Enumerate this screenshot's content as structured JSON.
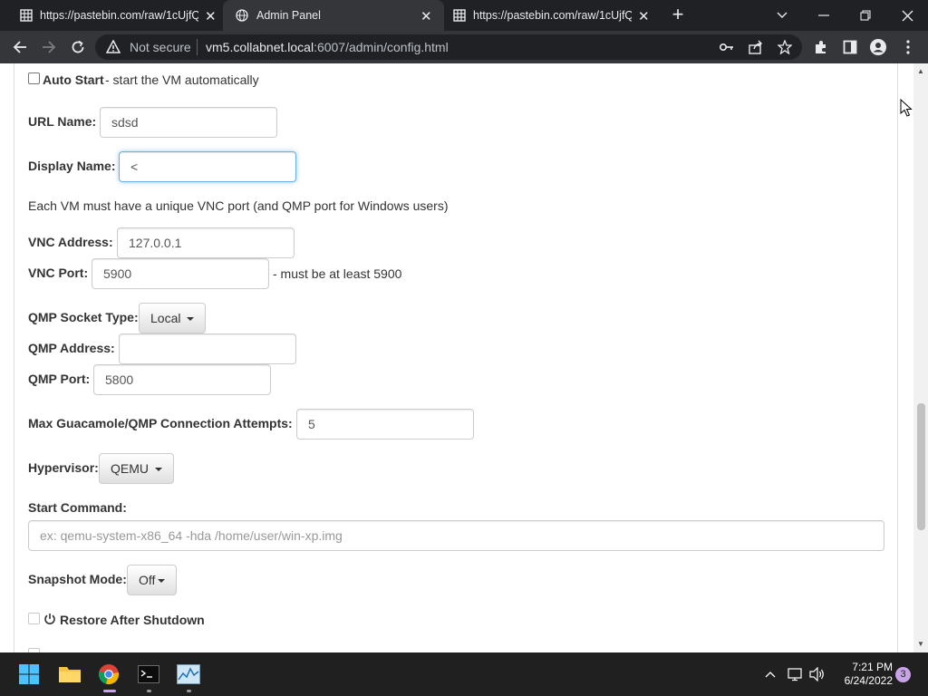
{
  "browser": {
    "tabs": [
      {
        "title": "https://pastebin.com/raw/1cUjfQ",
        "active": false
      },
      {
        "title": "Admin Panel",
        "active": true
      },
      {
        "title": "https://pastebin.com/raw/1cUjfQ",
        "active": false
      }
    ],
    "security_label": "Not secure",
    "url_host": "vm5.collabnet.local",
    "url_rest": ":6007/admin/config.html"
  },
  "form": {
    "auto_start": {
      "label": "Auto Start",
      "desc": " - start the VM automatically",
      "checked": false
    },
    "url_name": {
      "label": "URL Name:",
      "value": "sdsd"
    },
    "display_name": {
      "label": "Display Name:",
      "value": "<"
    },
    "vnc_note": "Each VM must have a unique VNC port (and QMP port for Windows users)",
    "vnc_address": {
      "label": "VNC Address:",
      "value": "127.0.0.1"
    },
    "vnc_port": {
      "label": "VNC Port:",
      "value": "5900",
      "hint": "- must be at least 5900"
    },
    "qmp_socket_type": {
      "label": "QMP Socket Type:",
      "value": "Local"
    },
    "qmp_address": {
      "label": "QMP Address:",
      "value": ""
    },
    "qmp_port": {
      "label": "QMP Port:",
      "value": "5800"
    },
    "max_attempts": {
      "label": "Max Guacamole/QMP Connection Attempts:",
      "value": "5"
    },
    "hypervisor": {
      "label": "Hypervisor:",
      "value": "QEMU"
    },
    "start_command": {
      "label": "Start Command:",
      "placeholder": "ex: qemu-system-x86_64 -hda /home/user/win-xp.img"
    },
    "snapshot_mode": {
      "label": "Snapshot Mode:",
      "value": "Off"
    },
    "restore_after_shutdown": {
      "label": "Restore After Shutdown",
      "checked": false
    }
  },
  "taskbar": {
    "time": "7:21 PM",
    "date": "6/24/2022",
    "notification_count": "3"
  },
  "colors": {
    "chrome_dark": "#202124",
    "chrome_toolbar": "#35363a",
    "focus_blue": "#66afe9",
    "taskbar": "#202020"
  }
}
